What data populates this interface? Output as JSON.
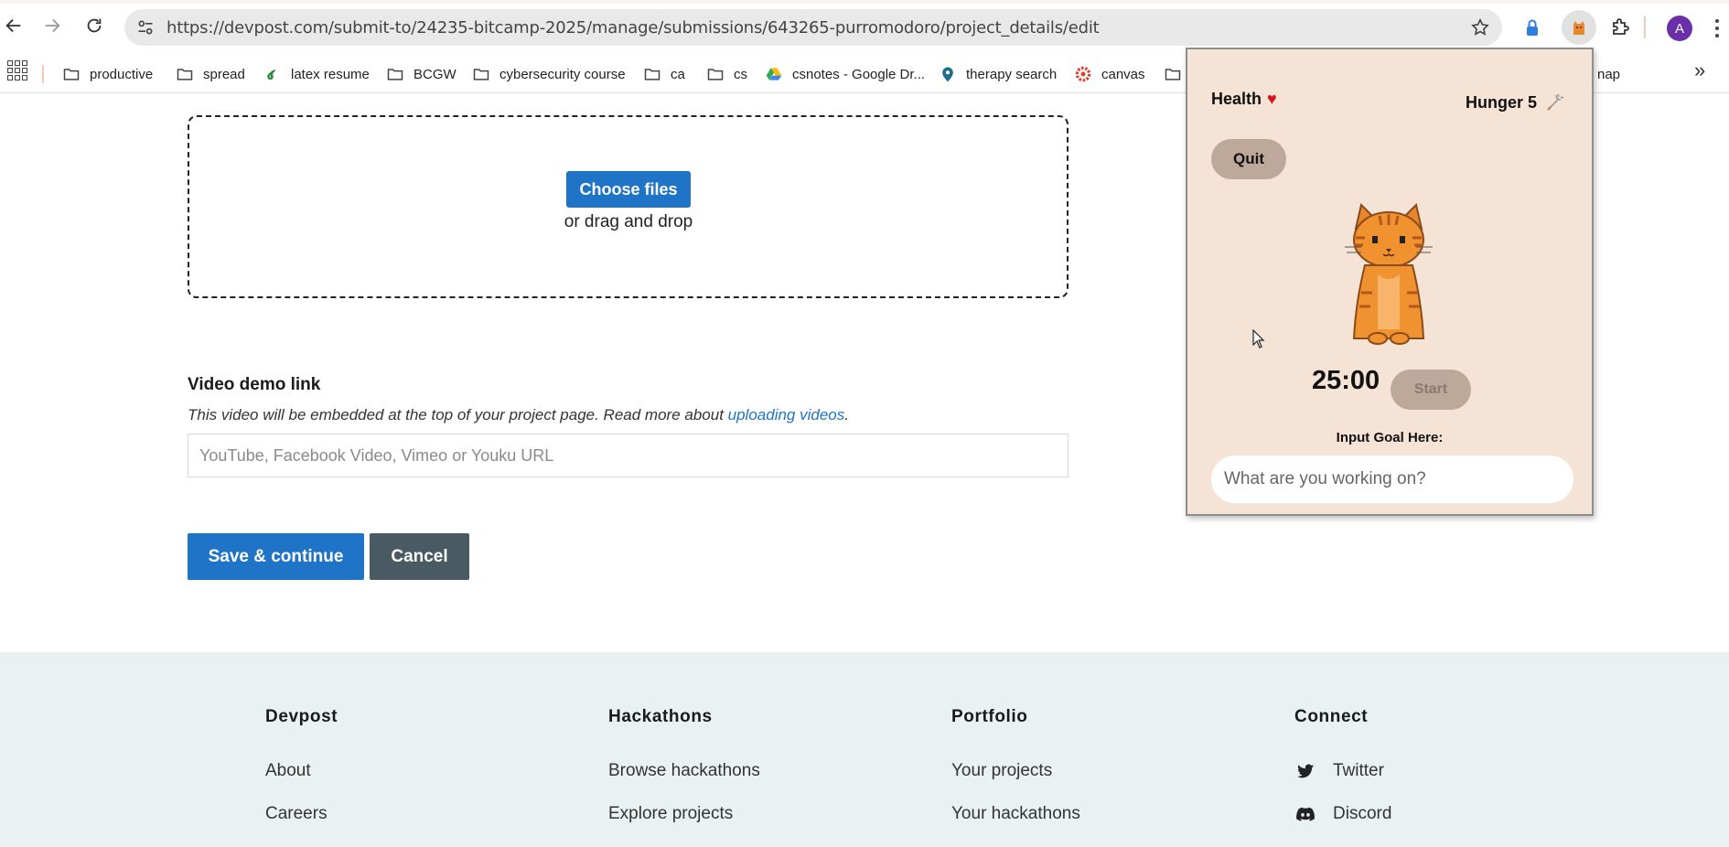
{
  "browser": {
    "url": "https://devpost.com/submit-to/24235-bitcamp-2025/manage/submissions/643265-purromodoro/project_details/edit",
    "avatar_letter": "A",
    "bookmarks": [
      {
        "label": "productive",
        "icon": "folder-icon"
      },
      {
        "label": "spread",
        "icon": "folder-icon"
      },
      {
        "label": "latex resume",
        "icon": "overleaf-icon"
      },
      {
        "label": "BCGW",
        "icon": "folder-icon"
      },
      {
        "label": "cybersecurity course",
        "icon": "folder-icon"
      },
      {
        "label": "ca",
        "icon": "folder-icon"
      },
      {
        "label": "cs",
        "icon": "folder-icon"
      },
      {
        "label": "csnotes - Google Dr...",
        "icon": "google-drive-icon"
      },
      {
        "label": "therapy search",
        "icon": "map-pin-icon"
      },
      {
        "label": "canvas",
        "icon": "canvas-icon"
      },
      {
        "label": "",
        "icon": "folder-icon"
      },
      {
        "label": "nap",
        "icon": ""
      }
    ],
    "more_label": "»"
  },
  "upload": {
    "choose_label": "Choose files",
    "drag_label": "or drag and drop"
  },
  "video": {
    "label": "Video demo link",
    "help_prefix": "This video will be embedded at the top of your project page. Read more about ",
    "help_link": "uploading videos",
    "help_suffix": ".",
    "placeholder": "YouTube, Facebook Video, Vimeo or Youku URL"
  },
  "actions": {
    "save_label": "Save & continue",
    "cancel_label": "Cancel"
  },
  "footer": {
    "columns": [
      {
        "heading": "Devpost",
        "links": [
          "About",
          "Careers"
        ]
      },
      {
        "heading": "Hackathons",
        "links": [
          "Browse hackathons",
          "Explore projects"
        ]
      },
      {
        "heading": "Portfolio",
        "links": [
          "Your projects",
          "Your hackathons"
        ]
      },
      {
        "heading": "Connect",
        "links": [
          "Twitter",
          "Discord"
        ]
      }
    ]
  },
  "extension": {
    "health_label": "Health",
    "hunger_label": "Hunger 5",
    "quit_label": "Quit",
    "timer": "25:00",
    "start_label": "Start",
    "goal_label": "Input Goal Here:",
    "goal_placeholder": "What are you working on?"
  },
  "colors": {
    "primary_blue": "#1f74c7",
    "cancel_gray": "#4a5a62",
    "footer_bg": "#eaf1f1",
    "popup_bg": "#f5e3d6",
    "popup_button": "#bda89a",
    "heart_red": "#d8151f"
  }
}
